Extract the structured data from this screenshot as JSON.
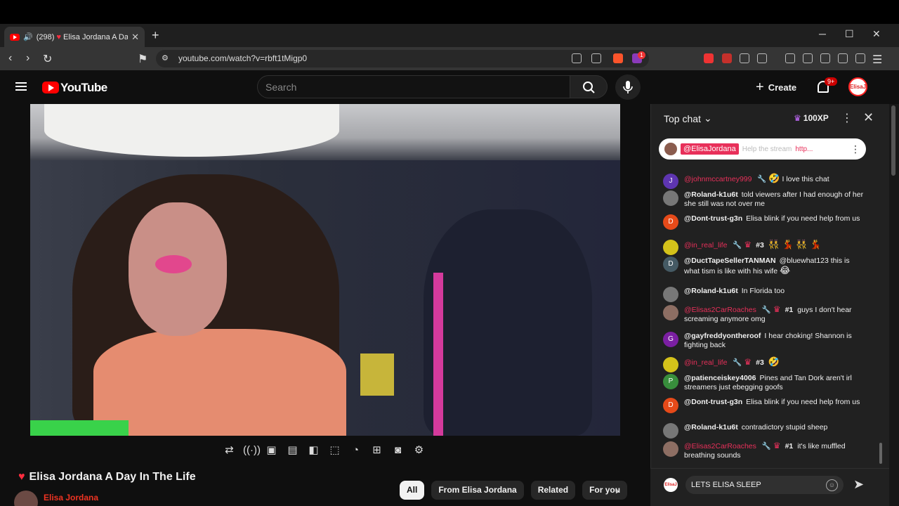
{
  "browser": {
    "tab": {
      "count_label": "(298)",
      "title": "Elisa Jordana A Day",
      "favicon": "youtube-icon"
    },
    "address": "youtube.com/watch?v=rbft1tMigp0",
    "ext_badge": "1"
  },
  "header": {
    "logo": "YouTube",
    "search_placeholder": "Search",
    "create_label": "Create",
    "notif_badge": "9+",
    "avatar_text": "ElisaJ"
  },
  "video": {
    "title": "Elisa Jordana A Day In The Life",
    "channel": "Elisa Jordana",
    "chips": [
      "All",
      "From Elisa Jordana",
      "Related",
      "For you"
    ]
  },
  "chat": {
    "header": "Top chat",
    "xp": "100XP",
    "pinned": {
      "author": "@ElisaJordana",
      "text": "Help the stream",
      "link": "http..."
    },
    "messages": [
      {
        "author": "@johnmccartney999",
        "member": true,
        "rank": "",
        "text": "I love this chat",
        "emoji": "🤣",
        "avatar": "J",
        "color": "#5e35b1"
      },
      {
        "author": "@Roland-k1u6t",
        "member": false,
        "rank": "",
        "text": "told viewers after I had enough of her she still was not over me",
        "emoji": "",
        "avatar": "",
        "color": "#777"
      },
      {
        "author": "@Dont-trust-g3n",
        "member": false,
        "rank": "",
        "text": "Elisa blink if you need help from us",
        "emoji": "",
        "avatar": "D",
        "color": "#e64a19"
      },
      {
        "author": "@in_real_life",
        "member": true,
        "rank": "#3",
        "text": "",
        "emoji": "👯 💃 👯 💃",
        "avatar": "",
        "color": "#d4c21a"
      },
      {
        "author": "@DuctTapeSellerTANMAN",
        "member": false,
        "rank": "",
        "text": "@bluewhat123 this is what tism is like with his wife",
        "emoji": "😂",
        "avatar": "D",
        "color": "#455a64"
      },
      {
        "author": "@Roland-k1u6t",
        "member": false,
        "rank": "",
        "text": "In Florida too",
        "emoji": "",
        "avatar": "",
        "color": "#777"
      },
      {
        "author": "@Elisas2CarRoaches",
        "member": true,
        "rank": "#1",
        "text": "guys I don't hear screaming anymore omg",
        "emoji": "",
        "avatar": "",
        "color": "#8d6e63"
      },
      {
        "author": "@gayfreddyontheroof",
        "member": false,
        "rank": "",
        "text": "I hear choking! Shannon is fighting back",
        "emoji": "",
        "avatar": "G",
        "color": "#7b1fa2"
      },
      {
        "author": "@in_real_life",
        "member": true,
        "rank": "#3",
        "text": "",
        "emoji": "🤣",
        "avatar": "",
        "color": "#d4c21a"
      },
      {
        "author": "@patienceiskey4006",
        "member": false,
        "rank": "",
        "text": "Pines and Tan Dork aren't irl streamers just ebegging goofs",
        "emoji": "",
        "avatar": "P",
        "color": "#388e3c"
      },
      {
        "author": "@Dont-trust-g3n",
        "member": false,
        "rank": "",
        "text": "Elisa blink if you need help from us",
        "emoji": "",
        "avatar": "D",
        "color": "#e64a19"
      },
      {
        "author": "@Roland-k1u6t",
        "member": false,
        "rank": "",
        "text": "contradictory stupid sheep",
        "emoji": "",
        "avatar": "",
        "color": "#777"
      },
      {
        "author": "@Elisas2CarRoaches",
        "member": true,
        "rank": "#1",
        "text": "it's like muffled breathing sounds",
        "emoji": "",
        "avatar": "",
        "color": "#8d6e63"
      }
    ],
    "input_value": "LETS ELISA SLEEP",
    "input_avatar_text": "ElisaJ"
  }
}
